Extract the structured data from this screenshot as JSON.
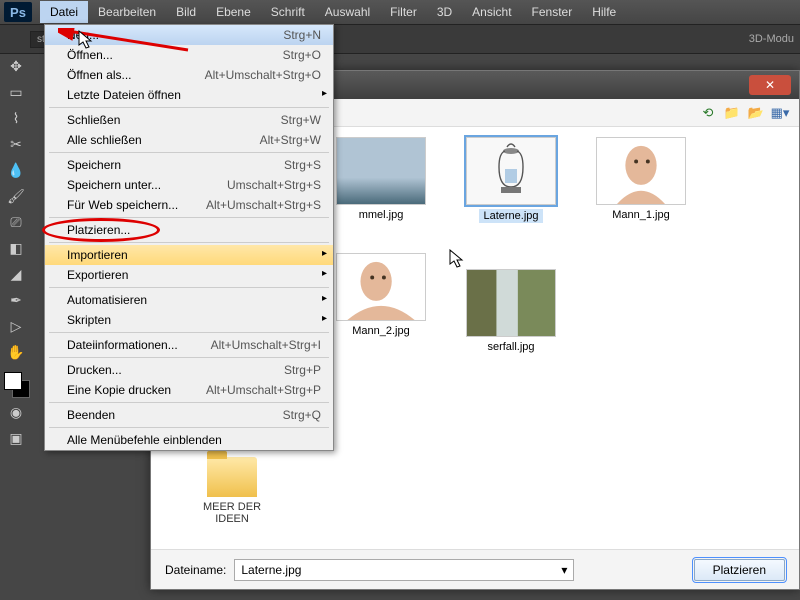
{
  "app": {
    "logo": "Ps"
  },
  "menubar": [
    "Datei",
    "Bearbeiten",
    "Bild",
    "Ebene",
    "Schrift",
    "Auswahl",
    "Filter",
    "3D",
    "Ansicht",
    "Fenster",
    "Hilfe"
  ],
  "toolbar": {
    "strg_label": "strg.",
    "mode3d": "3D-Modu"
  },
  "file_menu": {
    "neu": {
      "label": "Neu...",
      "shortcut": "Strg+N"
    },
    "oeffnen": {
      "label": "Öffnen...",
      "shortcut": "Strg+O"
    },
    "oeffnen_als": {
      "label": "Öffnen als...",
      "shortcut": "Alt+Umschalt+Strg+O"
    },
    "letzte": {
      "label": "Letzte Dateien öffnen",
      "shortcut": ""
    },
    "schliessen": {
      "label": "Schließen",
      "shortcut": "Strg+W"
    },
    "alle_schliessen": {
      "label": "Alle schließen",
      "shortcut": "Alt+Strg+W"
    },
    "speichern": {
      "label": "Speichern",
      "shortcut": "Strg+S"
    },
    "speichern_unter": {
      "label": "Speichern unter...",
      "shortcut": "Umschalt+Strg+S"
    },
    "fuer_web": {
      "label": "Für Web speichern...",
      "shortcut": "Alt+Umschalt+Strg+S"
    },
    "platzieren": {
      "label": "Platzieren...",
      "shortcut": ""
    },
    "importieren": {
      "label": "Importieren",
      "shortcut": ""
    },
    "exportieren": {
      "label": "Exportieren",
      "shortcut": ""
    },
    "automatisieren": {
      "label": "Automatisieren",
      "shortcut": ""
    },
    "skripten": {
      "label": "Skripten",
      "shortcut": ""
    },
    "dateiinfo": {
      "label": "Dateiinformationen...",
      "shortcut": "Alt+Umschalt+Strg+I"
    },
    "drucken": {
      "label": "Drucken...",
      "shortcut": "Strg+P"
    },
    "kopie_drucken": {
      "label": "Eine Kopie drucken",
      "shortcut": "Alt+Umschalt+Strg+P"
    },
    "beenden": {
      "label": "Beenden",
      "shortcut": "Strg+Q"
    },
    "alle_einblenden": {
      "label": "Alle Menübefehle einblenden",
      "shortcut": ""
    }
  },
  "dialog": {
    "folder_name": "MEER DER IDEEN",
    "files": {
      "himmel": "mmel.jpg",
      "laterne": "Laterne.jpg",
      "mann1": "Mann_1.jpg",
      "mann2": "Mann_2.jpg",
      "wasserfall": "serfall.jpg"
    },
    "filename_label": "Dateiname:",
    "filename_value": "Laterne.jpg",
    "submit": "Platzieren"
  }
}
